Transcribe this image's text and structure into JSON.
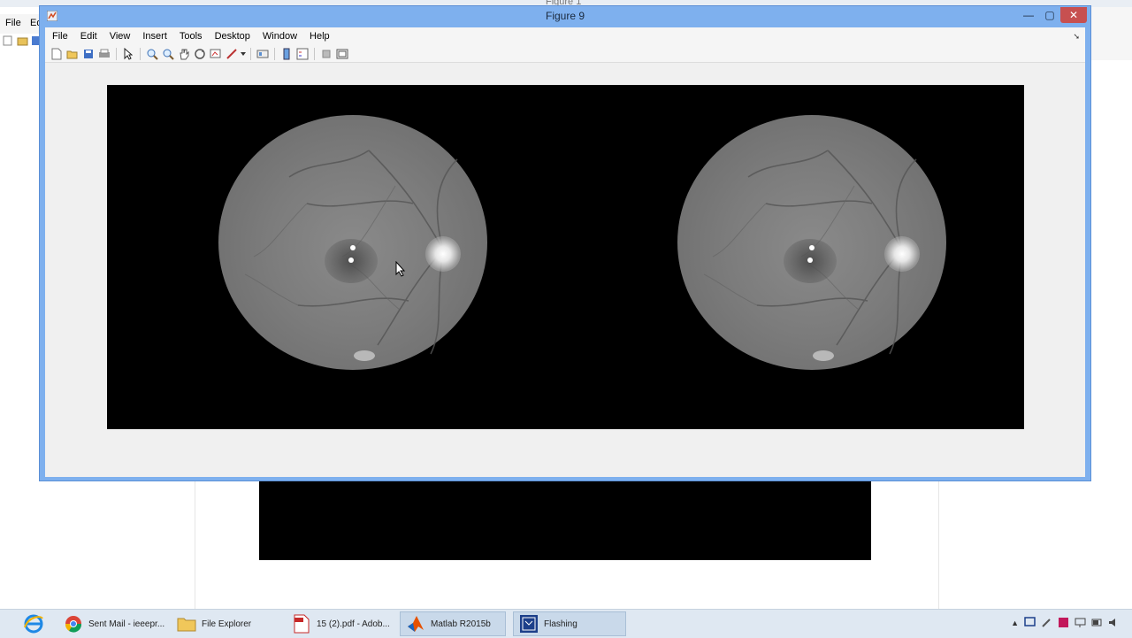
{
  "background": {
    "figure1_title": "Figure 1",
    "menu": [
      "File",
      "Ed"
    ]
  },
  "window": {
    "title": "Figure 9",
    "buttons": {
      "minimize": "—",
      "maximize": "▢",
      "close": "✕"
    }
  },
  "menubar": {
    "items": [
      "File",
      "Edit",
      "View",
      "Insert",
      "Tools",
      "Desktop",
      "Window",
      "Help"
    ]
  },
  "toolbar": {
    "icons": [
      "new-figure-icon",
      "open-file-icon",
      "save-figure-icon",
      "print-icon",
      "edit-plot-icon",
      "zoom-in-icon",
      "zoom-out-icon",
      "pan-icon",
      "rotate-3d-icon",
      "data-cursor-icon",
      "brush-icon",
      "link-plot-icon",
      "insert-colorbar-icon",
      "insert-legend-icon",
      "hide-plot-tools-icon",
      "show-plot-tools-icon"
    ]
  },
  "taskbar": {
    "items": [
      {
        "icon": "internet-explorer-icon",
        "label": ""
      },
      {
        "icon": "chrome-icon",
        "label": "Sent Mail - ieeepr..."
      },
      {
        "icon": "file-explorer-icon",
        "label": "File Explorer"
      },
      {
        "icon": "acrobat-icon",
        "label": "15 (2).pdf - Adob..."
      },
      {
        "icon": "matlab-icon",
        "label": "Matlab R2015b"
      },
      {
        "icon": "flashing-app-icon",
        "label": "Flashing"
      }
    ]
  },
  "colors": {
    "title_bar": "#7eb0ee",
    "close_button": "#c75050",
    "taskbar": "#dfe8f2"
  }
}
